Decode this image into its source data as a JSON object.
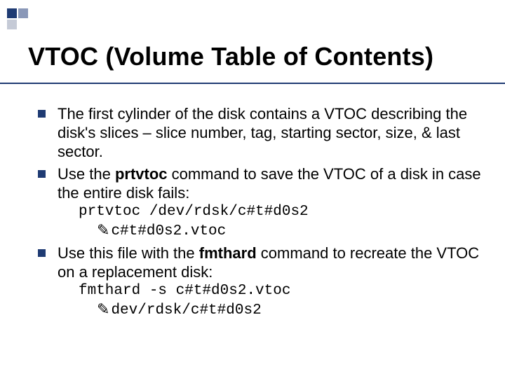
{
  "title": "VTOC (Volume Table of Contents)",
  "bullets": [
    {
      "text": "The first cylinder of the disk contains a VTOC describing the disk's slices – slice number, tag, starting sector, size, & last sector."
    },
    {
      "pre": "Use the ",
      "bold": "prtvtoc",
      "post": " command to save the VTOC of a disk in case the entire disk fails:",
      "code1": "prtvtoc /dev/rdsk/c#t#d0s2",
      "code2_arrow": "✎",
      "code2": "c#t#d0s2.vtoc"
    },
    {
      "pre": "Use this file with the ",
      "bold": "fmthard",
      "post": " command to recreate the VTOC on a replacement disk:",
      "code1": "fmthard -s c#t#d0s2.vtoc",
      "code2_arrow": "✎",
      "code2": "dev/rdsk/c#t#d0s2"
    }
  ]
}
